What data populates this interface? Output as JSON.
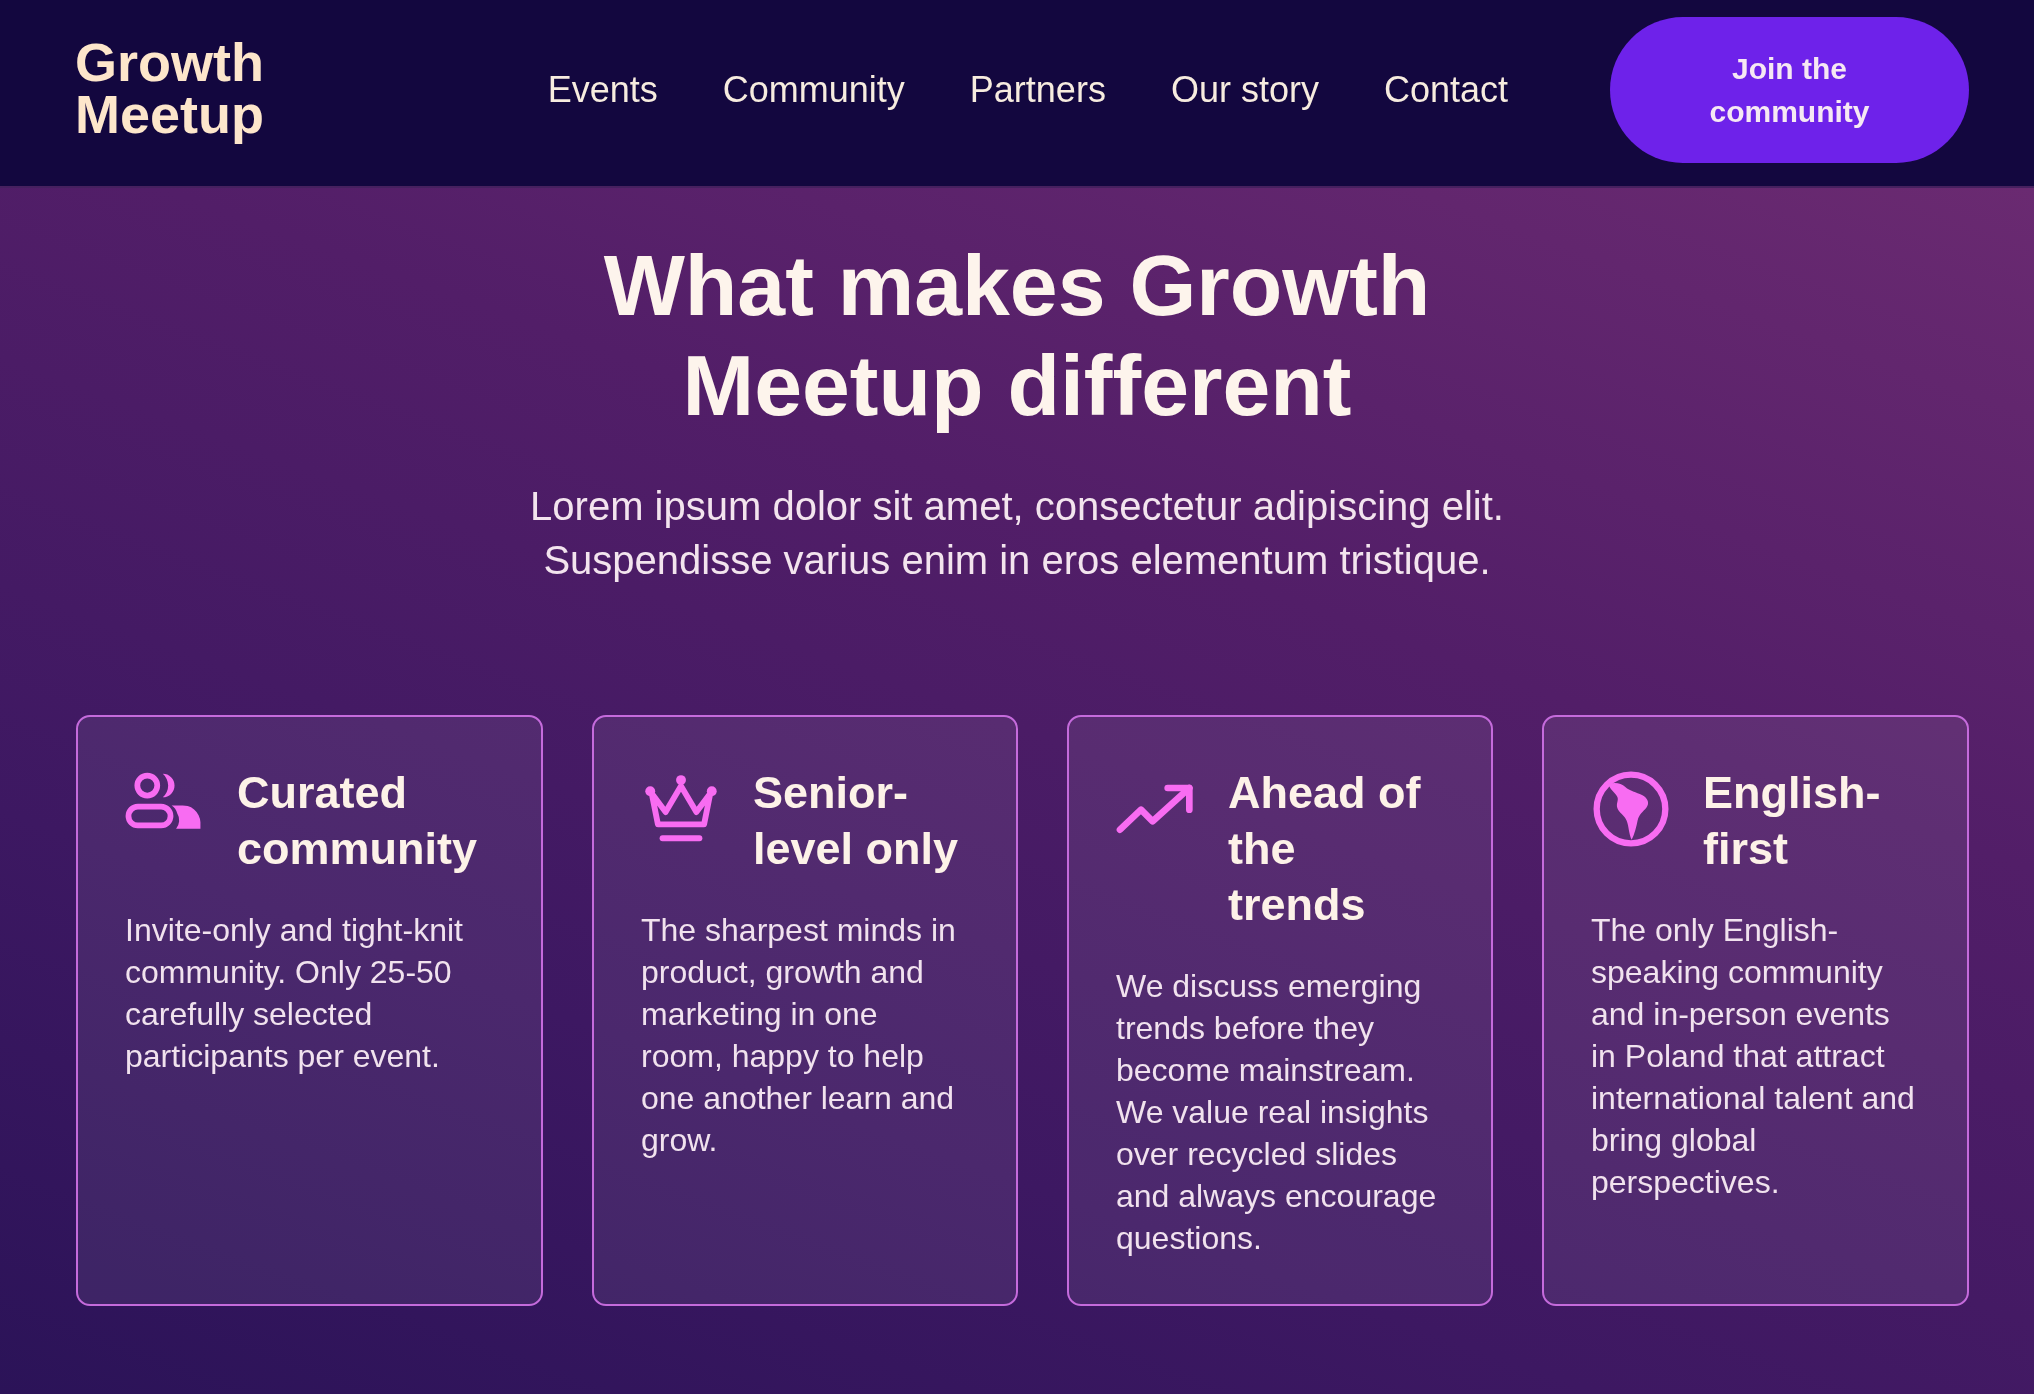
{
  "header": {
    "logo": "Growth Meetup",
    "nav": [
      {
        "label": "Events"
      },
      {
        "label": "Community"
      },
      {
        "label": "Partners"
      },
      {
        "label": "Our story"
      },
      {
        "label": "Contact"
      }
    ],
    "cta": "Join the community"
  },
  "hero": {
    "title": "What makes Growth Meetup different",
    "subtitle": "Lorem ipsum dolor sit amet, consectetur adipiscing elit. Suspendisse varius enim in eros elementum tristique."
  },
  "features": [
    {
      "kind": "people",
      "title": "Curated community",
      "description": "Invite-only and tight-knit community. Only 25-50 carefully selected participants per event."
    },
    {
      "kind": "crown",
      "title": "Senior-level only",
      "description": "The sharpest minds in product, growth and marketing in one room, happy to help one another learn and grow."
    },
    {
      "kind": "trend",
      "title": "Ahead of the trends",
      "description": "We discuss emerging trends before they become mainstream. We value real insights over recycled slides and always encourage questions."
    },
    {
      "kind": "globe",
      "title": "English-first",
      "description": "The only English-speaking community and in-person events in Poland that attract international talent and bring global perspectives."
    }
  ]
}
